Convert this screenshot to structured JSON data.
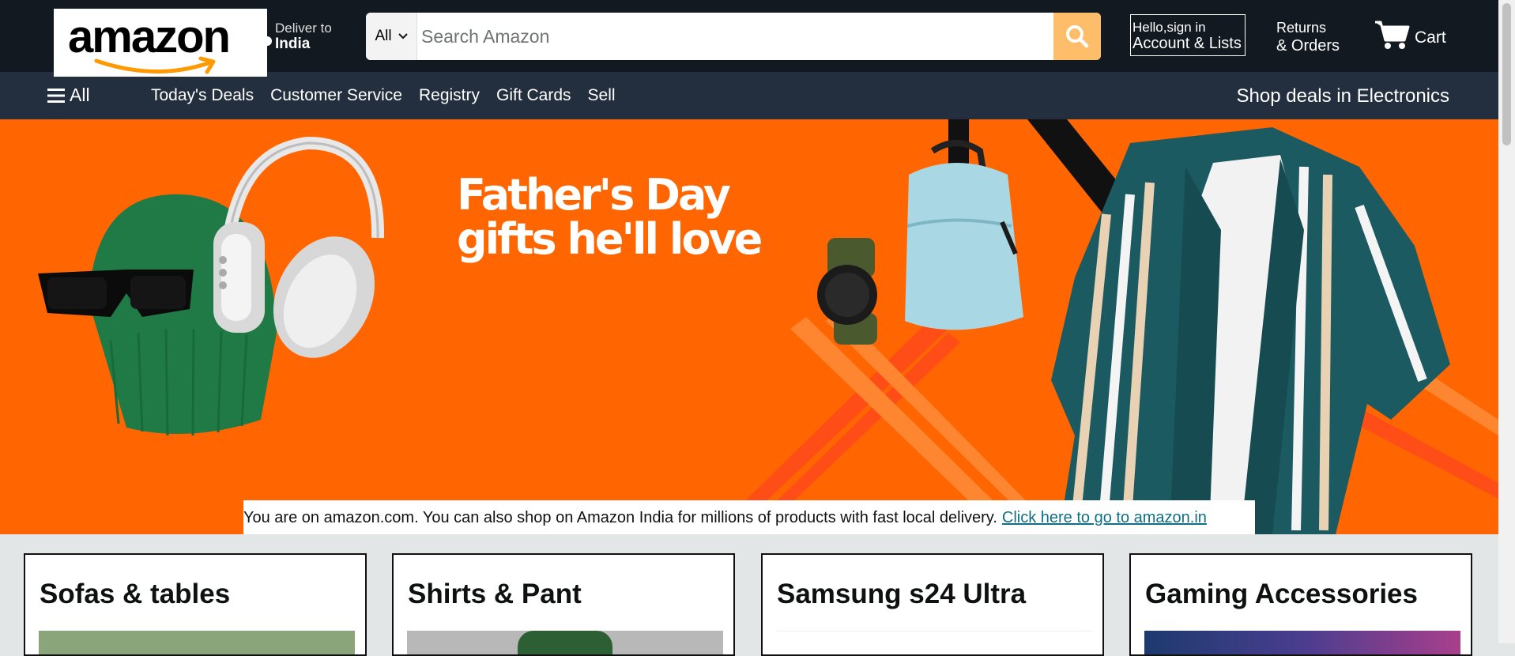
{
  "header": {
    "logo_text": "amazon",
    "deliver": {
      "line1": "Deliver to",
      "line2": "India"
    },
    "search": {
      "category": "All",
      "placeholder": "Search Amazon",
      "icon": "search-icon"
    },
    "account": {
      "line1": "Hello,sign in",
      "line2": "Account & Lists"
    },
    "returns": {
      "line1": "Returns",
      "line2": "& Orders"
    },
    "cart": {
      "label": "Cart",
      "icon": "cart-icon"
    }
  },
  "subnav": {
    "all_label": "All",
    "links": [
      "Today's Deals",
      "Customer Service",
      "Registry",
      "Gift Cards",
      "Sell"
    ],
    "promo": "Shop deals in Electronics"
  },
  "hero": {
    "title_line1": "Father's Day",
    "title_line2": "gifts he'll love",
    "notice_text": "You are on amazon.com. You can also shop on Amazon India for millions of products with fast local delivery.",
    "notice_link": "Click here to go to amazon.in"
  },
  "cards": [
    {
      "title": "Sofas & tables"
    },
    {
      "title": "Shirts & Pant"
    },
    {
      "title": "Samsung s24 Ultra"
    },
    {
      "title": "Gaming Accessories"
    }
  ],
  "colors": {
    "topbar": "#131921",
    "subnav": "#232f3e",
    "accent": "#febd69",
    "hero_bg": "#ff6500",
    "link": "#0e6f85",
    "logo_smile": "#ff9900"
  }
}
